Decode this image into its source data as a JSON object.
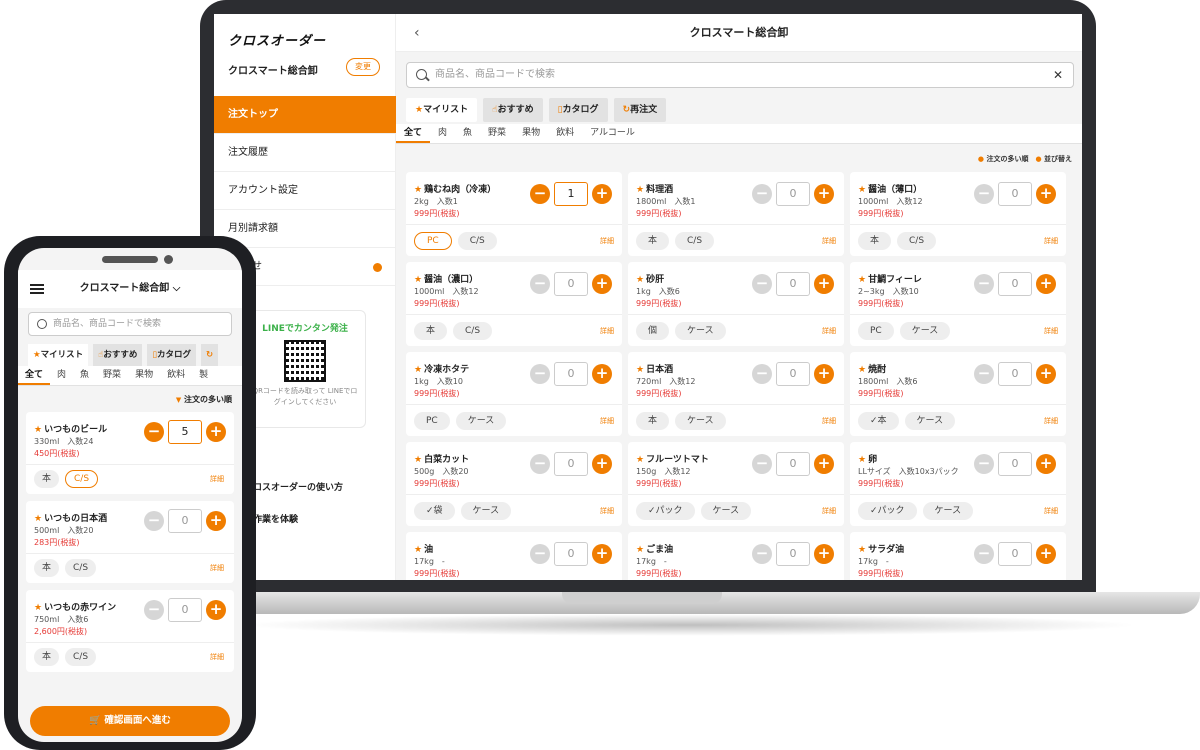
{
  "brand": {
    "logo": "クロスオーダー",
    "accent": "#f07d00"
  },
  "desktop": {
    "sidebar": {
      "shop_name": "クロスマート総合卸",
      "change_label": "変更",
      "items": [
        {
          "label": "注文トップ"
        },
        {
          "label": "注文履歴"
        },
        {
          "label": "アカウント設定"
        },
        {
          "label": "月別請求額"
        },
        {
          "label": "せ"
        }
      ],
      "line": {
        "title": "LINEでカンタン発注",
        "note": "QRコードを読み取って LINEでログインしてください"
      },
      "links": [
        "クロスオーダーの使い方",
        "文作業を体験"
      ]
    },
    "header": {
      "back": "‹",
      "title": "クロスマート総合卸"
    },
    "search": {
      "placeholder": "商品名、商品コードで検索",
      "clear": "✕"
    },
    "tabs": [
      "マイリスト",
      "おすすめ",
      "カタログ",
      "再注文"
    ],
    "categories": [
      "全て",
      "肉",
      "魚",
      "野菜",
      "果物",
      "飲料",
      "アルコール"
    ],
    "sort": {
      "primary": "注文の多い順",
      "secondary": "並び替え"
    },
    "products": [
      {
        "name": "鶏むね肉（冷凍）",
        "spec": "2kg　入数1",
        "price": "999円(税抜)",
        "qty": "1",
        "active": true,
        "units": [
          "PC",
          "C/S"
        ],
        "detail": "詳細"
      },
      {
        "name": "料理酒",
        "spec": "1800ml　入数1",
        "price": "999円(税抜)",
        "qty": "0",
        "units": [
          "本",
          "C/S"
        ],
        "detail": "詳細"
      },
      {
        "name": "醤油（薄口）",
        "spec": "1000ml　入数12",
        "price": "999円(税抜)",
        "qty": "0",
        "units": [
          "本",
          "C/S"
        ],
        "detail": "詳細"
      },
      {
        "name": "醤油（濃口）",
        "spec": "1000ml　入数12",
        "price": "999円(税抜)",
        "qty": "0",
        "units": [
          "本",
          "C/S"
        ],
        "detail": "詳細"
      },
      {
        "name": "砂肝",
        "spec": "1kg　入数6",
        "price": "999円(税抜)",
        "qty": "0",
        "units": [
          "個",
          "ケース"
        ],
        "detail": "詳細"
      },
      {
        "name": "甘鯛フィーレ",
        "spec": "2~3kg　入数10",
        "price": "999円(税抜)",
        "qty": "0",
        "units": [
          "PC",
          "ケース"
        ],
        "detail": "詳細"
      },
      {
        "name": "冷凍ホタテ",
        "spec": "1kg　入数10",
        "price": "999円(税抜)",
        "qty": "0",
        "units": [
          "PC",
          "ケース"
        ],
        "detail": "詳細"
      },
      {
        "name": "日本酒",
        "spec": "720ml　入数12",
        "price": "999円(税抜)",
        "qty": "0",
        "units": [
          "本",
          "ケース"
        ],
        "detail": "詳細"
      },
      {
        "name": "焼酎",
        "spec": "1800ml　入数6",
        "price": "999円(税抜)",
        "qty": "0",
        "units": [
          "✓本",
          "ケース"
        ],
        "detail": "詳細"
      },
      {
        "name": "白菜カット",
        "spec": "500g　入数20",
        "price": "999円(税抜)",
        "qty": "0",
        "units": [
          "✓袋",
          "ケース"
        ],
        "detail": "詳細"
      },
      {
        "name": "フルーツトマト",
        "spec": "150g　入数12",
        "price": "999円(税抜)",
        "qty": "0",
        "units": [
          "✓パック",
          "ケース"
        ],
        "detail": "詳細"
      },
      {
        "name": "卵",
        "spec": "LLサイズ　入数10x3パック",
        "price": "999円(税抜)",
        "qty": "0",
        "units": [
          "✓パック",
          "ケース"
        ],
        "detail": "詳細"
      },
      {
        "name": "油",
        "spec": "17kg　-",
        "price": "999円(税抜)",
        "qty": "0",
        "units": [],
        "detail": ""
      },
      {
        "name": "ごま油",
        "spec": "17kg　-",
        "price": "999円(税抜)",
        "qty": "0",
        "units": [],
        "detail": ""
      },
      {
        "name": "サラダ油",
        "spec": "17kg　-",
        "price": "999円(税抜)",
        "qty": "0",
        "units": [],
        "detail": ""
      }
    ]
  },
  "mobile": {
    "header": {
      "title": "クロスマート総合卸 ⌵"
    },
    "search": {
      "placeholder": "商品名、商品コードで検索"
    },
    "tabs": [
      "マイリスト",
      "おすすめ",
      "カタログ",
      ""
    ],
    "categories": [
      "全て",
      "肉",
      "魚",
      "野菜",
      "果物",
      "飲料",
      "製"
    ],
    "sort": "注文の多い順",
    "products": [
      {
        "name": "いつものビール",
        "spec": "330ml　入数24",
        "price": "450円(税抜)",
        "qty": "5",
        "active": true,
        "units": [
          "本",
          "C/S"
        ],
        "detail": "詳細"
      },
      {
        "name": "いつもの日本酒",
        "spec": "500ml　入数20",
        "price": "283円(税抜)",
        "qty": "0",
        "units": [
          "本",
          "C/S"
        ],
        "detail": "詳細"
      },
      {
        "name": "いつもの赤ワイン",
        "spec": "750ml　入数6",
        "price": "2,600円(税抜)",
        "qty": "0",
        "units": [
          "本",
          "C/S"
        ],
        "detail": "詳細"
      }
    ],
    "cta": "確認画面へ進む"
  }
}
